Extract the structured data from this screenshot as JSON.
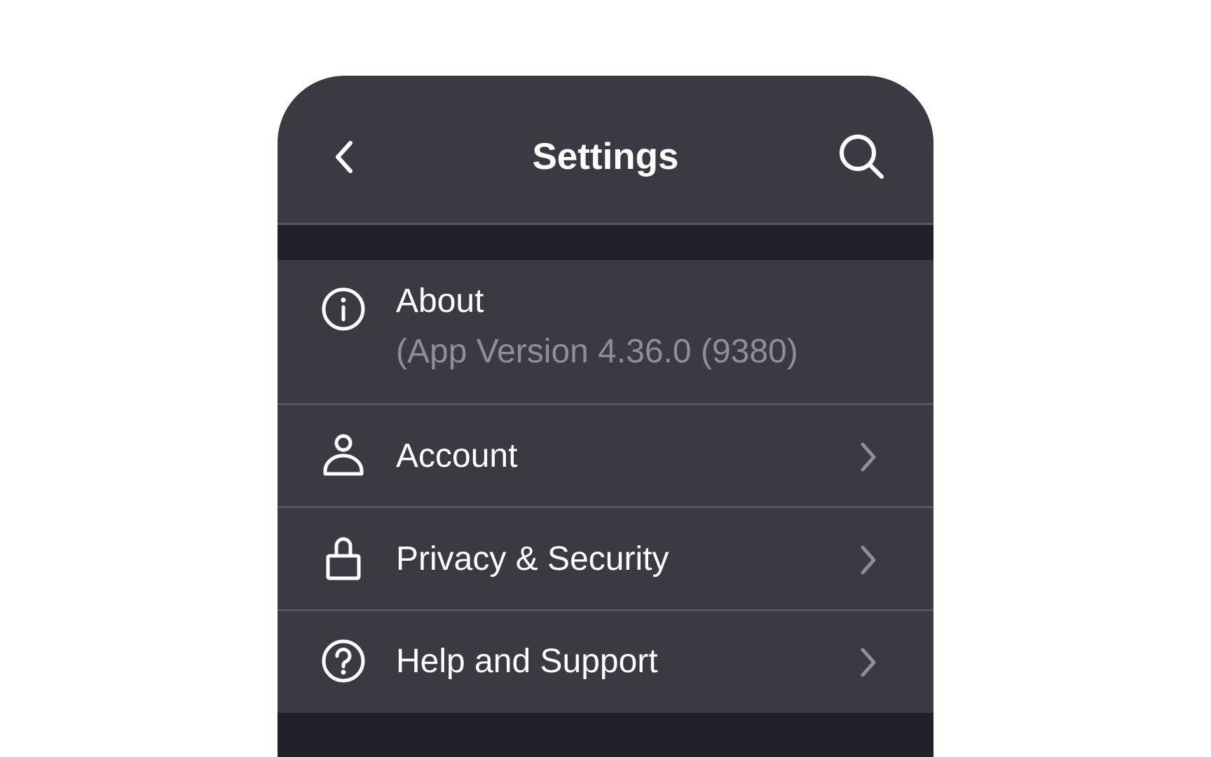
{
  "header": {
    "title": "Settings",
    "back_icon": "chevron-left-icon",
    "search_icon": "search-icon"
  },
  "menu": {
    "items": [
      {
        "id": "about",
        "icon": "info-circle-icon",
        "label": "About",
        "sublabel": "(App Version 4.36.0 (9380)"
      },
      {
        "id": "account",
        "icon": "person-icon",
        "label": "Account",
        "chevron": "chevron-right-icon"
      },
      {
        "id": "privacy-security",
        "icon": "lock-icon",
        "label": "Privacy & Security",
        "chevron": "chevron-right-icon"
      },
      {
        "id": "help-support",
        "icon": "question-circle-icon",
        "label": "Help and Support",
        "chevron": "chevron-right-icon"
      }
    ]
  },
  "colors": {
    "page_background": "#ffffff",
    "panel_background": "#3a3b42",
    "section_gap": "#212129",
    "divider": "#55565d",
    "primary_text": "#ffffff",
    "secondary_text": "#8e8f95",
    "chevron": "#8e8f95"
  }
}
